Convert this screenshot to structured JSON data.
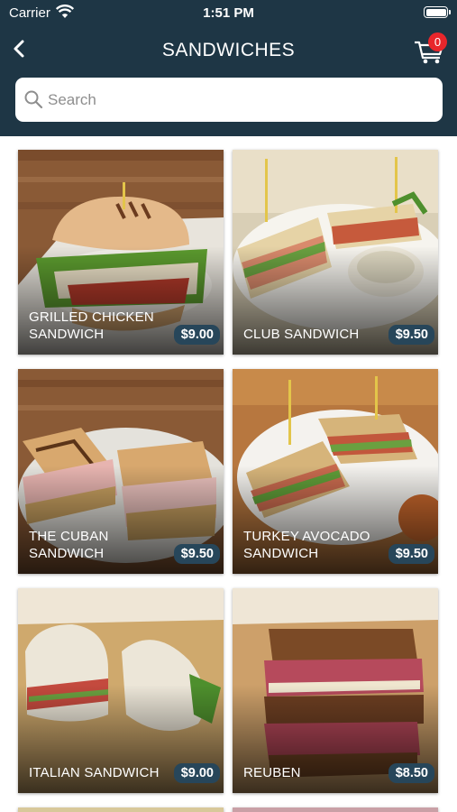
{
  "status_bar": {
    "carrier": "Carrier",
    "time": "1:51 PM"
  },
  "nav": {
    "title": "SANDWICHES",
    "cart_count": "0"
  },
  "search": {
    "placeholder": "Search"
  },
  "colors": {
    "header": "#1e3645",
    "badge": "#e8262b",
    "price_pill": "#27465a"
  },
  "products": [
    {
      "name": "GRILLED CHICKEN SANDWICH",
      "price": "$9.00"
    },
    {
      "name": "CLUB SANDWICH",
      "price": "$9.50"
    },
    {
      "name": "THE CUBAN SANDWICH",
      "price": "$9.50"
    },
    {
      "name": "TURKEY AVOCADO SANDWICH",
      "price": "$9.50"
    },
    {
      "name": "ITALIAN SANDWICH",
      "price": "$9.00"
    },
    {
      "name": "REUBEN",
      "price": "$8.50"
    }
  ]
}
